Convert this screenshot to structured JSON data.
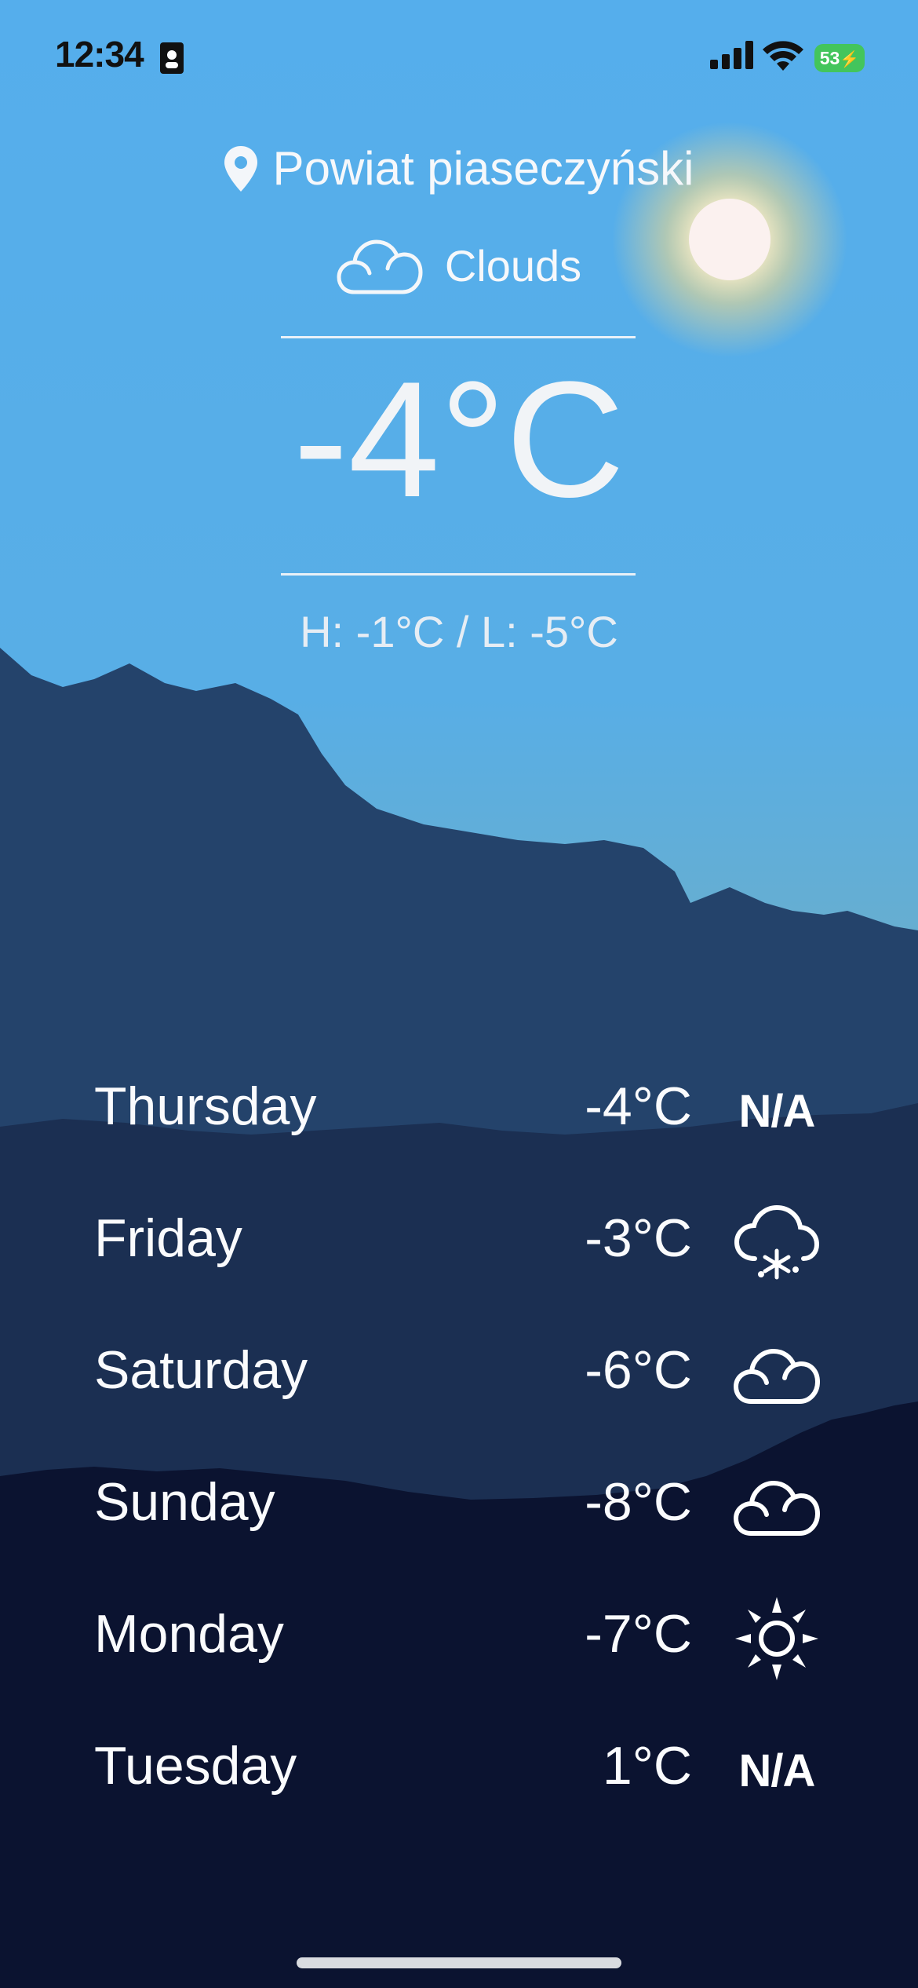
{
  "status_bar": {
    "time": "12:34",
    "battery": "53"
  },
  "current": {
    "location": "Powiat piaseczyński",
    "condition": "Clouds",
    "condition_icon": "cloud-icon",
    "temperature": "-4°C",
    "high_low": "H: -1°C / L: -5°C"
  },
  "forecast": [
    {
      "day": "Thursday",
      "temp": "-4°C",
      "icon": "na",
      "icon_text": "N/A"
    },
    {
      "day": "Friday",
      "temp": "-3°C",
      "icon": "snow-cloud-icon",
      "icon_text": ""
    },
    {
      "day": "Saturday",
      "temp": "-6°C",
      "icon": "cloud-icon",
      "icon_text": ""
    },
    {
      "day": "Sunday",
      "temp": "-8°C",
      "icon": "cloud-icon",
      "icon_text": ""
    },
    {
      "day": "Monday",
      "temp": "-7°C",
      "icon": "sun-icon",
      "icon_text": ""
    },
    {
      "day": "Tuesday",
      "temp": "1°C",
      "icon": "na",
      "icon_text": "N/A"
    }
  ],
  "colors": {
    "sky": "#55aeea",
    "mountain_near": "#24436b",
    "mountain_mid": "#1b2f52",
    "mountain_far": "#0b1330",
    "battery": "#43c55c"
  }
}
